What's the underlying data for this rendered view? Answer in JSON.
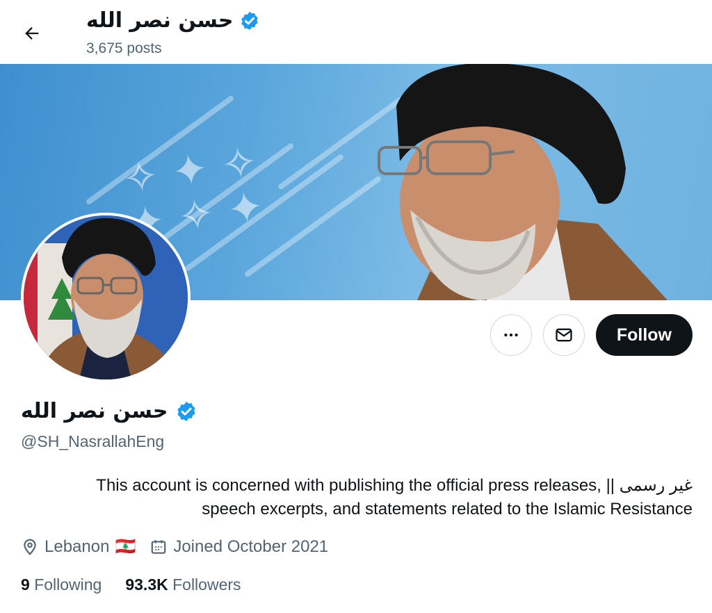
{
  "header": {
    "back_icon": "arrow-left-icon",
    "name": "حسن نصر الله",
    "posts_count": "3,675 posts"
  },
  "profile": {
    "name": "حسن نصر الله",
    "verified_icon": "verified-badge-icon",
    "handle": "@SH_NasrallahEng",
    "bio_line1": "This account is concerned with publishing the official press releases, || غير رسمى",
    "bio_line2": "speech excerpts, and statements related to the Islamic Resistance",
    "location": "Lebanon",
    "location_flag": "🇱🇧",
    "joined": "Joined October 2021",
    "following_count": "9",
    "following_label": "Following",
    "followers_count": "93.3K",
    "followers_label": "Followers"
  },
  "actions": {
    "more_icon": "more-horizontal-icon",
    "message_icon": "mail-icon",
    "follow_label": "Follow"
  },
  "colors": {
    "verified": "#1d9bf0",
    "text_primary": "#0f1419",
    "text_secondary": "#536471",
    "follow_bg": "#0f1419",
    "banner_bg": "#5aa6dc"
  }
}
